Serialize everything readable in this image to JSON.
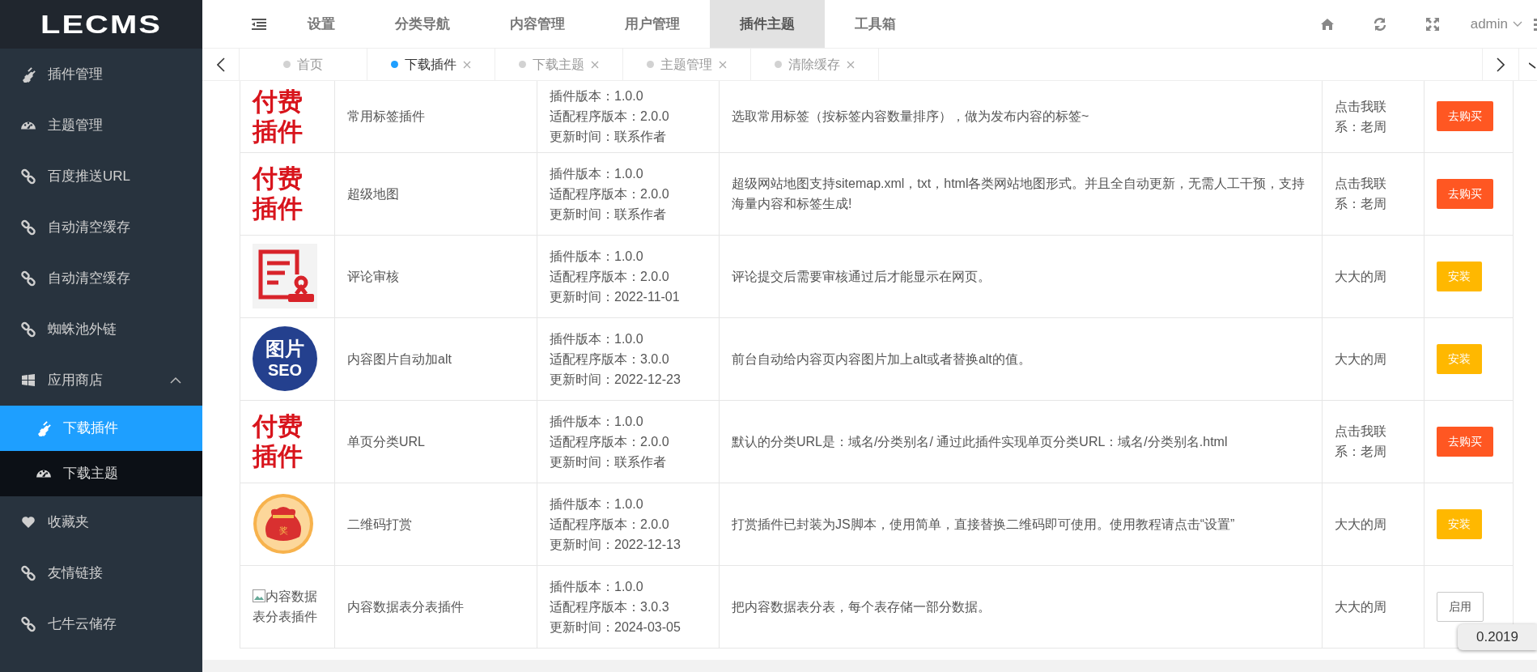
{
  "logo": "LECMS",
  "top_nav": {
    "items": [
      {
        "label": "设置",
        "selected": false
      },
      {
        "label": "分类导航",
        "selected": false
      },
      {
        "label": "内容管理",
        "selected": false
      },
      {
        "label": "用户管理",
        "selected": false
      },
      {
        "label": "插件主题",
        "selected": true
      },
      {
        "label": "工具箱",
        "selected": false
      }
    ],
    "user": "admin"
  },
  "sidebar": {
    "items": [
      {
        "label": "插件管理",
        "kind": "plug"
      },
      {
        "label": "主题管理",
        "kind": "gauge"
      },
      {
        "label": "百度推送URL",
        "kind": "link"
      },
      {
        "label": "自动清空缓存",
        "kind": "link"
      },
      {
        "label": "自动清空缓存",
        "kind": "link"
      },
      {
        "label": "蜘蛛池外链",
        "kind": "link"
      },
      {
        "label": "应用商店",
        "kind": "windows",
        "expanded": true,
        "children": [
          {
            "label": "下载插件",
            "kind": "plug",
            "selected": true
          },
          {
            "label": "下载主题",
            "kind": "gauge",
            "selected": false
          }
        ]
      },
      {
        "label": "收藏夹",
        "kind": "heart"
      },
      {
        "label": "友情链接",
        "kind": "link"
      },
      {
        "label": "七牛云储存",
        "kind": "link"
      }
    ]
  },
  "tabs": [
    {
      "label": "首页",
      "selected": false,
      "closable": false
    },
    {
      "label": "下载插件",
      "selected": true,
      "closable": true
    },
    {
      "label": "下载主题",
      "selected": false,
      "closable": true
    },
    {
      "label": "主题管理",
      "selected": false,
      "closable": true
    },
    {
      "label": "清除缓存",
      "selected": false,
      "closable": true
    }
  ],
  "table": {
    "rows": [
      {
        "image": {
          "kind": "paid",
          "label": "付费插件"
        },
        "name": "常用标签插件",
        "version": [
          "插件版本：1.0.0",
          "适配程序版本：2.0.0",
          "更新时间：联系作者"
        ],
        "description": "选取常用标签（按标签内容数量排序），做为发布内容的标签~",
        "author": "点击我联系：老周",
        "action": {
          "kind": "buy",
          "label": "去购买"
        }
      },
      {
        "image": {
          "kind": "paid",
          "label": "付费插件"
        },
        "name": "超级地图",
        "version": [
          "插件版本：1.0.0",
          "适配程序版本：2.0.0",
          "更新时间：联系作者"
        ],
        "description": "超级网站地图支持sitemap.xml，txt，html各类网站地图形式。并且全自动更新，无需人工干预，支持海量内容和标签生成!",
        "author": "点击我联系：老周",
        "action": {
          "kind": "buy",
          "label": "去购买"
        }
      },
      {
        "image": {
          "kind": "document"
        },
        "name": "评论审核",
        "version": [
          "插件版本：1.0.0",
          "适配程序版本：2.0.0",
          "更新时间：2022-11-01"
        ],
        "description": "评论提交后需要审核通过后才能显示在网页。",
        "author": "大大的周",
        "action": {
          "kind": "install",
          "label": "安装"
        }
      },
      {
        "image": {
          "kind": "seo",
          "label": "图片",
          "sublabel": "SEO"
        },
        "name": "内容图片自动加alt",
        "version": [
          "插件版本：1.0.0",
          "适配程序版本：3.0.0",
          "更新时间：2022-12-23"
        ],
        "description": "前台自动给内容页内容图片加上alt或者替换alt的值。",
        "author": "大大的周",
        "action": {
          "kind": "install",
          "label": "安装"
        }
      },
      {
        "image": {
          "kind": "paid",
          "label": "付费插件"
        },
        "name": "单页分类URL",
        "version": [
          "插件版本：1.0.0",
          "适配程序版本：2.0.0",
          "更新时间：联系作者"
        ],
        "description": "默认的分类URL是：域名/分类别名/ 通过此插件实现单页分类URL：域名/分类别名.html",
        "author": "点击我联系：老周",
        "action": {
          "kind": "buy",
          "label": "去购买"
        }
      },
      {
        "image": {
          "kind": "gift",
          "label": "奖"
        },
        "name": "二维码打赏",
        "version": [
          "插件版本：1.0.0",
          "适配程序版本：2.0.0",
          "更新时间：2022-12-13"
        ],
        "description": "打赏插件已封装为JS脚本，使用简单，直接替换二维码即可使用。使用教程请点击“设置”",
        "author": "大大的周",
        "action": {
          "kind": "install",
          "label": "安装"
        }
      },
      {
        "image": {
          "kind": "broken",
          "label": "内容数据表分表插件"
        },
        "name": "内容数据表分表插件",
        "version": [
          "插件版本：1.0.0",
          "适配程序版本：3.0.3",
          "更新时间：2024-03-05"
        ],
        "description": "把内容数据表分表，每个表存储一部分数据。",
        "author": "大大的周",
        "action": {
          "kind": "enable",
          "label": "启用"
        }
      }
    ]
  },
  "floating_badge": "0.2019"
}
